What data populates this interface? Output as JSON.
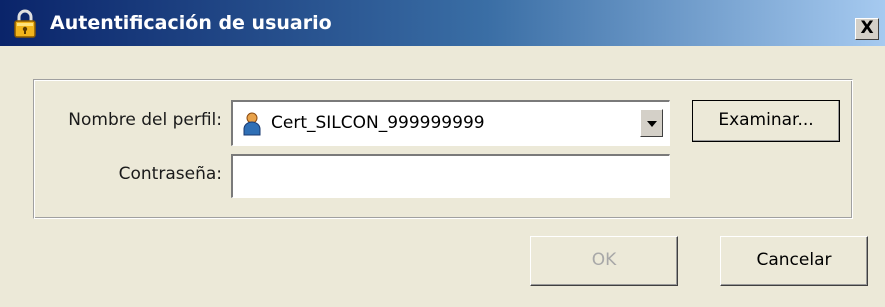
{
  "window": {
    "title": "Autentificación de usuario",
    "close_label": "X",
    "title_icon": "lock-icon"
  },
  "form": {
    "profile_label": "Nombre del perfil:",
    "profile_value": "Cert_SILCON_999999999",
    "profile_icon": "user-icon",
    "browse_label": "Examinar...",
    "password_label": "Contraseña:",
    "password_value": ""
  },
  "buttons": {
    "ok_label": "OK",
    "ok_enabled": false,
    "cancel_label": "Cancelar"
  },
  "colors": {
    "titlebar_start": "#0a246a",
    "titlebar_end": "#a6caf0",
    "dialog_bg": "#ece9d8",
    "disabled_text": "#a8a8a8"
  }
}
